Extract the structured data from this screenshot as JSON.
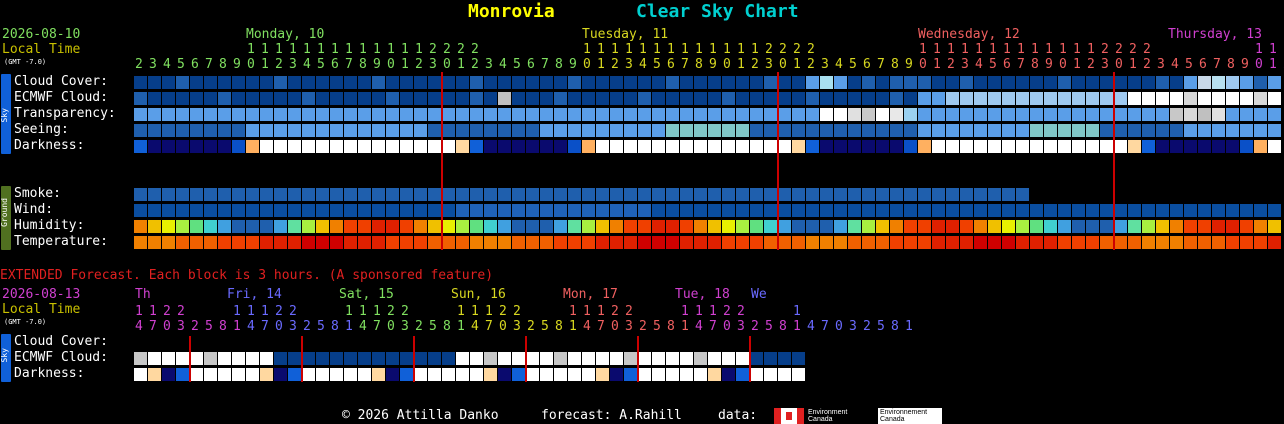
{
  "header": {
    "location": "Monrovia",
    "chart_title": "Clear Sky Chart",
    "date": "2026-08-10",
    "local_time": "Local Time",
    "gmt": "(GMT -7.0)"
  },
  "colors": {
    "yellow": "#ffff00",
    "cyan": "#00d0d0",
    "green": "#80e060",
    "olive": "#c8c000",
    "red_line": "#cc0000",
    "sky_tab": "#1060d8",
    "ground_tab": "#507020",
    "extended": "#e02020"
  },
  "days": [
    {
      "label": "Monday, 10",
      "color": "#80e060"
    },
    {
      "label": "Tuesday, 11",
      "color": "#d8d820"
    },
    {
      "label": "Wednesday, 12",
      "color": "#f06060"
    },
    {
      "label": "Thursday, 13",
      "color": "#d040d0"
    }
  ],
  "hours": {
    "tens": "11111111111112222",
    "ones": "234567890123456789012301234567890123456789012301234567890123456789012301234567890123456789012301"
  },
  "rows": {
    "sky": [
      "Cloud Cover:",
      "ECMWF Cloud:",
      "Transparency:",
      "Seeing:",
      "Darkness:"
    ],
    "ground": [
      "Smoke:",
      "Wind:",
      "Humidity:",
      "Temperature:"
    ]
  },
  "side_tabs": {
    "sky": "Sky",
    "ground": "Ground"
  },
  "extended": {
    "title": "EXTENDED Forecast. Each block is 3 hours. (A sponsored feature)",
    "date": "2026-08-13",
    "local_time": "Local Time",
    "gmt": "(GMT -7.0)",
    "days": [
      {
        "label": "Th",
        "color": "#d040d0"
      },
      {
        "label": "Fri, 14",
        "color": "#6a6aff"
      },
      {
        "label": "Sat, 15",
        "color": "#80e060"
      },
      {
        "label": "Sun, 16",
        "color": "#d8d820"
      },
      {
        "label": "Mon, 17",
        "color": "#f06060"
      },
      {
        "label": "Tue, 18",
        "color": "#d040d0"
      },
      {
        "label": "We",
        "color": "#6a6aff"
      }
    ],
    "tens_groups": [
      "1122",
      "11122",
      "11122",
      "11122",
      "11122",
      "11122",
      "1"
    ],
    "ones": "47032581470325814703258147032581470325814703258147032581",
    "rows": [
      "Cloud Cover:",
      "ECMWF Cloud:",
      "Darkness:"
    ]
  },
  "footer": {
    "copyright": "© 2026 Attilla Danko",
    "forecast": "forecast: A.Rahill",
    "data": "data:",
    "agency_en": "Environment Canada",
    "agency_fr": "Environnement Canada"
  }
}
